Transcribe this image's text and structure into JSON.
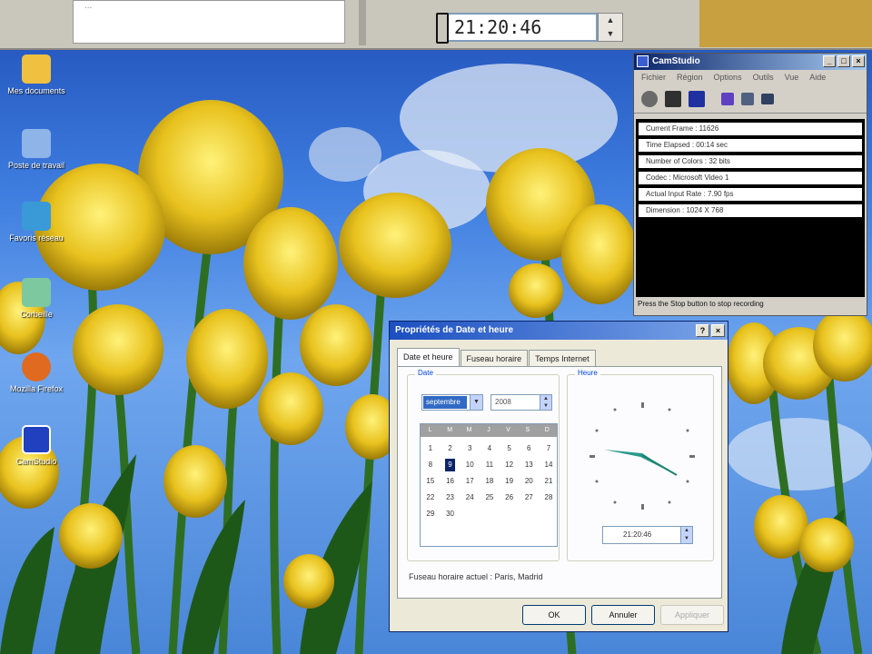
{
  "top_strip": {
    "left_text": "...",
    "time_value": "21:20:46",
    "spin_up": "▲",
    "spin_down": "▼"
  },
  "desktop_icons": [
    {
      "label": "Mes documents",
      "color": "#f0c040"
    },
    {
      "label": "Poste de travail",
      "color": "#8fb4e8"
    },
    {
      "label": "Favoris réseau",
      "color": "#3a9ad8"
    },
    {
      "label": "Corbeille",
      "color": "#7ec8a0"
    },
    {
      "label": "Mozilla Firefox",
      "color": "#e06a20"
    },
    {
      "label": "CamStudio",
      "color": "#2040c0"
    }
  ],
  "recorder": {
    "title": "CamStudio",
    "title_buttons": [
      "_",
      "□",
      "×"
    ],
    "menu": [
      "Fichier",
      "Région",
      "Options",
      "Outils",
      "Vue",
      "Aide"
    ],
    "toolbar_icons": [
      {
        "name": "record-icon",
        "color": "#6a6a6a"
      },
      {
        "name": "pause-icon",
        "color": "#303030"
      },
      {
        "name": "stop-icon",
        "color": "#2030a0"
      },
      {
        "name": "annotate-icon",
        "color": "#6040c0"
      },
      {
        "name": "settings-icon",
        "color": "#506080"
      },
      {
        "name": "web-icon",
        "color": "#304060"
      }
    ],
    "stats": [
      "Current Frame : 11626",
      "Time Elapsed : 00:14 sec",
      "Number of Colors : 32 bits",
      "Codec : Microsoft Video 1",
      "Actual Input Rate : 7.90 fps",
      "Dimension : 1024 X 768"
    ],
    "status": "Press the Stop button to stop recording"
  },
  "dialog": {
    "title": "Propriétés de Date et heure",
    "title_buttons": [
      "?",
      "×"
    ],
    "tabs": [
      "Date et heure",
      "Fuseau horaire",
      "Temps Internet"
    ],
    "date_group_title": "Date",
    "time_group_title": "Heure",
    "month": "septembre",
    "year": "2008",
    "weekdays": [
      "L",
      "M",
      "M",
      "J",
      "V",
      "S",
      "D"
    ],
    "calendar_days": [
      "1",
      "2",
      "3",
      "4",
      "5",
      "6",
      "7",
      "8",
      "9",
      "10",
      "11",
      "12",
      "13",
      "14",
      "15",
      "16",
      "17",
      "18",
      "19",
      "20",
      "21",
      "22",
      "23",
      "24",
      "25",
      "26",
      "27",
      "28",
      "29",
      "30"
    ],
    "selected_day": "9",
    "time_value": "21:20:46",
    "timezone_text": "Fuseau horaire actuel : Paris, Madrid",
    "buttons": {
      "ok": "OK",
      "cancel": "Annuler",
      "apply": "Appliquer"
    }
  }
}
